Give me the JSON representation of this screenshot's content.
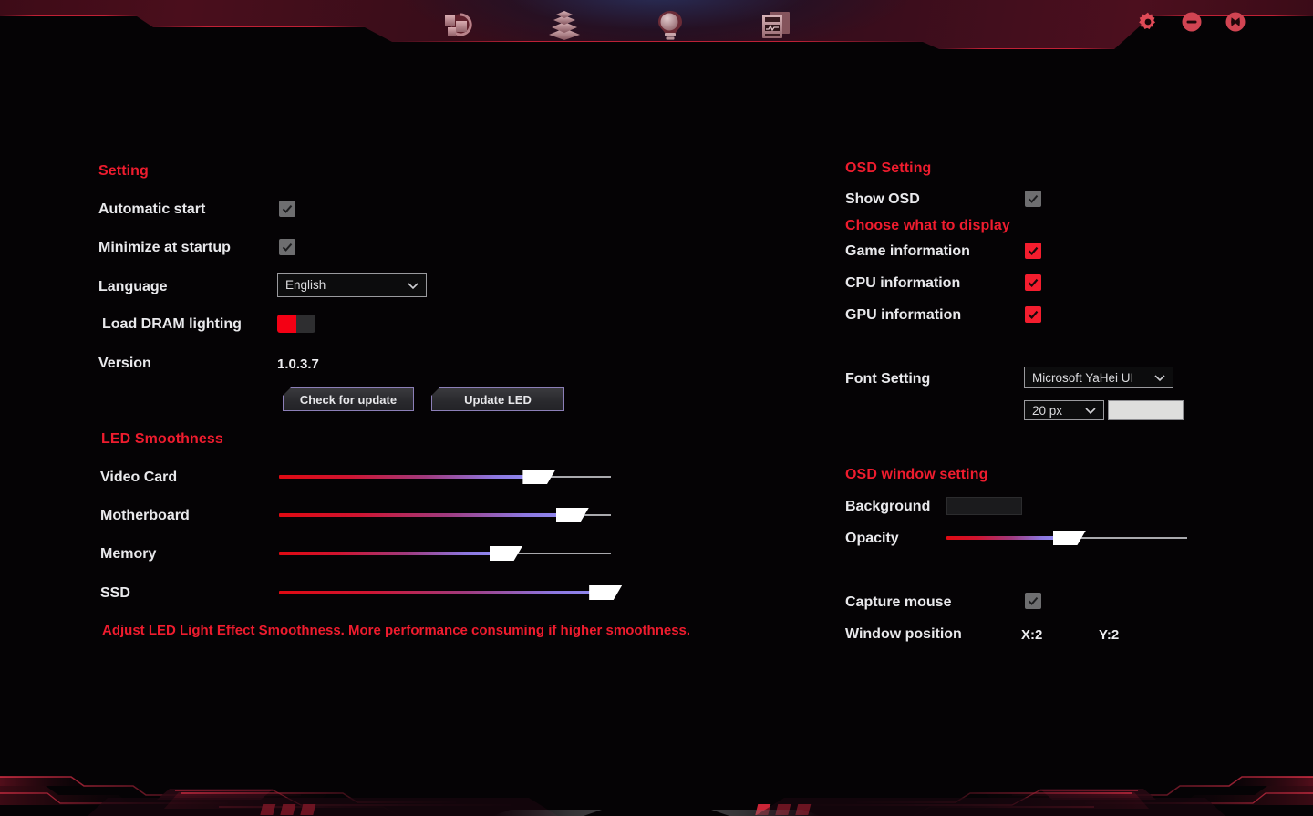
{
  "header": {
    "nav_items": [
      {
        "name": "sync-icon",
        "label": "Sync"
      },
      {
        "name": "layers-icon",
        "label": "Layers"
      },
      {
        "name": "bulb-icon",
        "label": "Lighting"
      },
      {
        "name": "monitor-icon",
        "label": "Monitoring"
      }
    ],
    "window_controls": [
      {
        "name": "gear-icon",
        "label": "Settings"
      },
      {
        "name": "minimize-icon",
        "label": "Minimize"
      },
      {
        "name": "close-icon",
        "label": "Close"
      }
    ]
  },
  "colors": {
    "accent_red": "#ee1c2e",
    "checkbox_red": "#f41d2e",
    "checkbox_gray": "#6e6e70",
    "toggle_on": "#f40014",
    "button_border": "#8c7fb8",
    "font_color_swatch": "#dededd",
    "background_swatch": "#1b1b1d"
  },
  "setting": {
    "title": "Setting",
    "automatic_start": {
      "label": "Automatic start",
      "checked": true,
      "state": "disabled"
    },
    "minimize_at_startup": {
      "label": "Minimize at startup",
      "checked": true,
      "state": "disabled"
    },
    "language": {
      "label": "Language",
      "value": "English",
      "options": [
        "English"
      ]
    },
    "load_dram_lighting": {
      "label": "Load DRAM lighting",
      "value": "on"
    },
    "version": {
      "label": "Version",
      "value": "1.0.3.7"
    },
    "check_for_update_button": "Check for update",
    "update_led_button": "Update LED"
  },
  "led_smoothness": {
    "title": "LED Smoothness",
    "sliders": [
      {
        "label": "Video Card",
        "value": 74
      },
      {
        "label": "Motherboard",
        "value": 84
      },
      {
        "label": "Memory",
        "value": 64
      },
      {
        "label": "SSD",
        "value": 94
      }
    ],
    "note": "Adjust LED Light Effect Smoothness. More performance consuming if higher smoothness."
  },
  "osd_setting": {
    "title": "OSD Setting",
    "show_osd": {
      "label": "Show OSD",
      "checked": true,
      "state": "disabled"
    },
    "choose_what_to_display": "Choose what to display",
    "items": [
      {
        "label": "Game information",
        "checked": true
      },
      {
        "label": "CPU information",
        "checked": true
      },
      {
        "label": "GPU information",
        "checked": true
      }
    ],
    "font_setting": {
      "label": "Font Setting",
      "family": "Microsoft YaHei UI",
      "size": "20 px",
      "color_swatch": "#dededd"
    }
  },
  "osd_window_setting": {
    "title": "OSD window setting",
    "background": {
      "label": "Background",
      "swatch": "#1b1b1d"
    },
    "opacity": {
      "label": "Opacity",
      "value": 45
    },
    "capture_mouse": {
      "label": "Capture mouse",
      "checked": true,
      "state": "disabled"
    },
    "window_position": {
      "label": "Window position",
      "x": "X:2",
      "y": "Y:2"
    }
  }
}
